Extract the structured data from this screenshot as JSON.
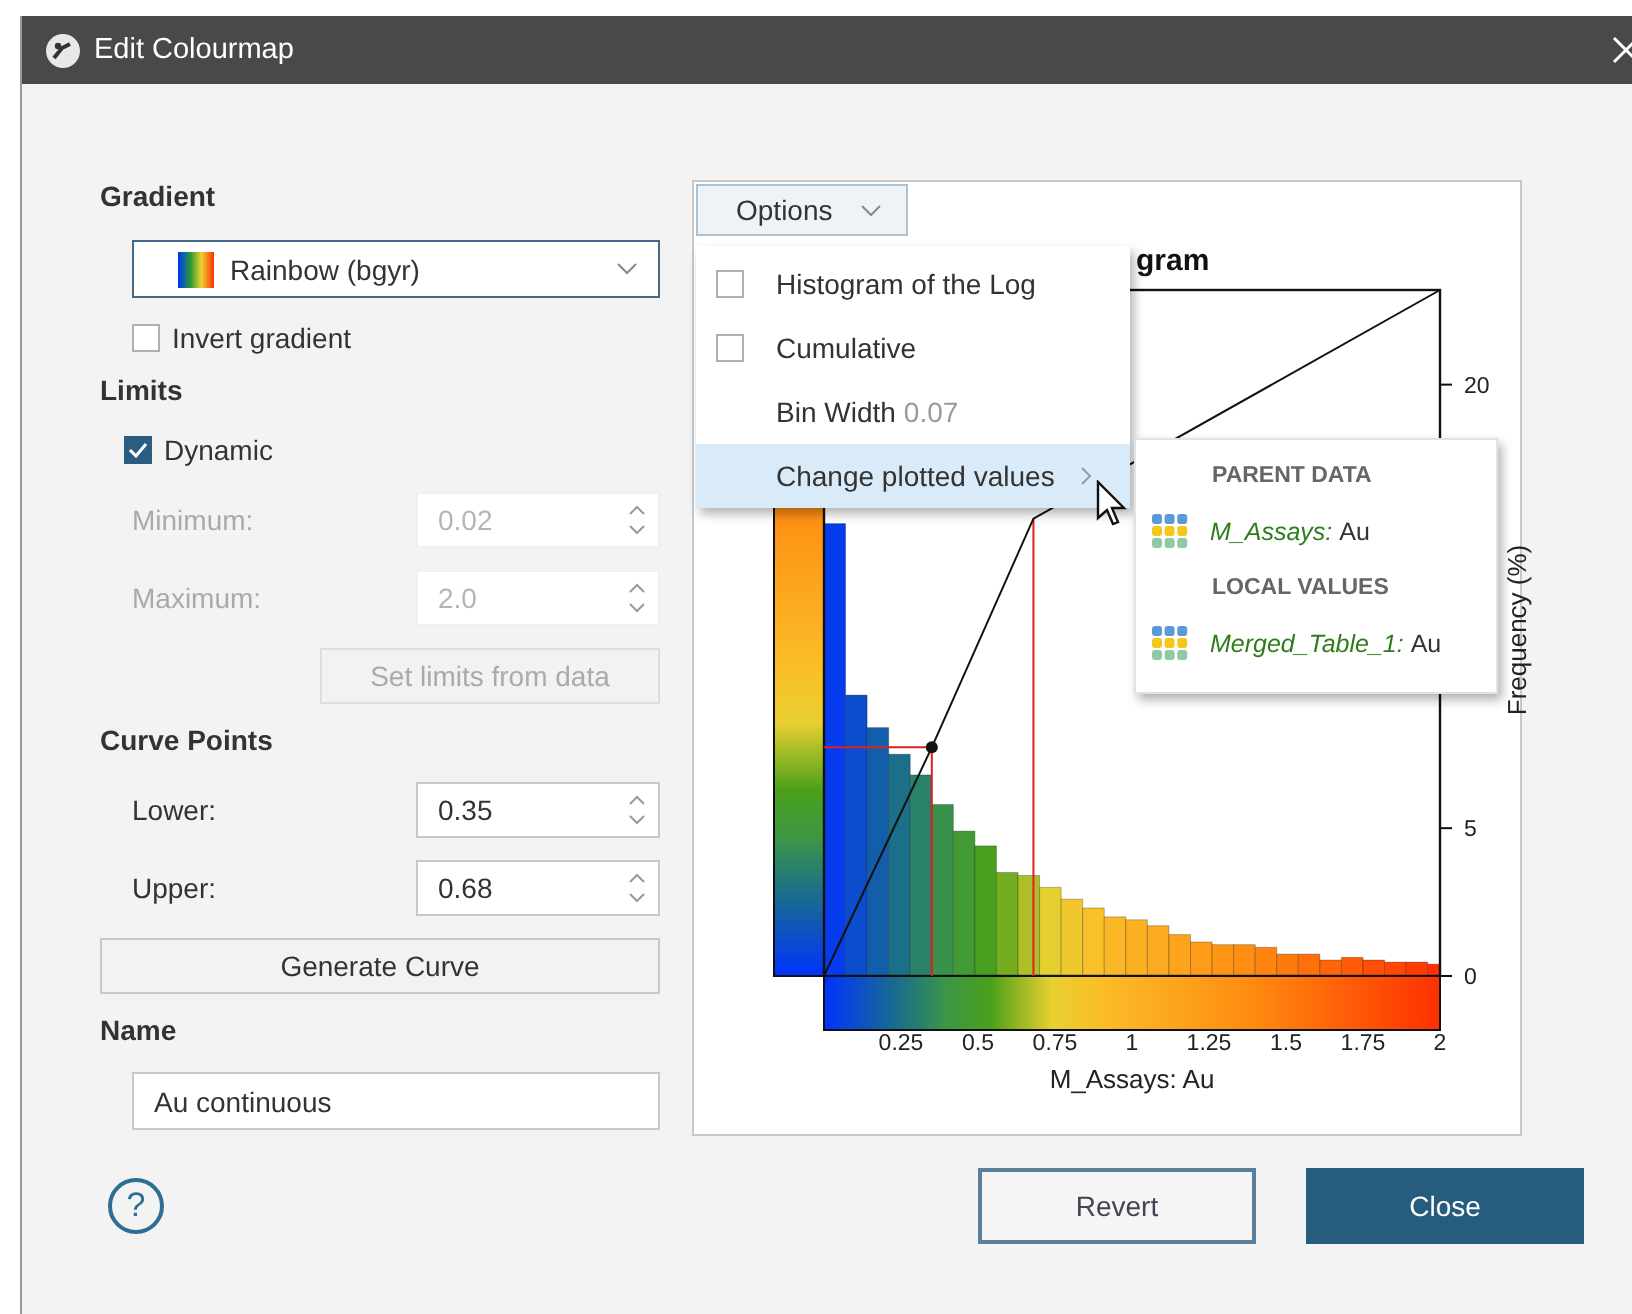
{
  "window": {
    "title": "Edit Colourmap"
  },
  "gradient": {
    "label": "Gradient",
    "value": "Rainbow (bgyr)",
    "invert": {
      "label": "Invert gradient",
      "checked": false
    }
  },
  "limits": {
    "label": "Limits",
    "dynamic": {
      "label": "Dynamic",
      "checked": true
    },
    "fields": [
      {
        "label": "Minimum:",
        "value": "0.02",
        "disabled": true
      },
      {
        "label": "Maximum:",
        "value": "2.0",
        "disabled": true
      }
    ],
    "set_button": {
      "label": "Set limits from data",
      "disabled": true
    }
  },
  "curve_points": {
    "label": "Curve Points",
    "fields": [
      {
        "label": "Lower:",
        "value": "0.35",
        "disabled": false
      },
      {
        "label": "Upper:",
        "value": "0.68",
        "disabled": false
      }
    ],
    "generate_button": "Generate Curve"
  },
  "name": {
    "label": "Name",
    "value": "Au continuous"
  },
  "chart_panel": {
    "options_button": "Options",
    "menu": [
      {
        "kind": "checkbox",
        "label": "Histogram of the Log",
        "checked": false,
        "selected": false
      },
      {
        "kind": "checkbox",
        "label": "Cumulative",
        "checked": false,
        "selected": false
      },
      {
        "kind": "value",
        "label": "Bin Width",
        "value": "0.07",
        "selected": false
      },
      {
        "kind": "submenu",
        "label": "Change plotted values",
        "selected": true
      }
    ],
    "submenu": [
      {
        "header": "PARENT DATA",
        "items": [
          {
            "source": "M_Assays:",
            "attribute": "Au"
          }
        ]
      },
      {
        "header": "LOCAL VALUES",
        "items": [
          {
            "source": "Merged_Table_1:",
            "attribute": "Au"
          }
        ]
      }
    ],
    "chart_data": {
      "type": "bar",
      "title": "gram",
      "xlabel": "M_Assays: Au",
      "ylabel": "Frequency (%)",
      "xlim": [
        0,
        2
      ],
      "ylim": [
        0,
        23.2
      ],
      "xticks": [
        0.25,
        0.5,
        0.75,
        1,
        1.25,
        1.5,
        1.75,
        2
      ],
      "yticks": [
        0,
        5,
        20
      ],
      "x": [
        0.035,
        0.105,
        0.175,
        0.245,
        0.315,
        0.385,
        0.455,
        0.525,
        0.595,
        0.665,
        0.735,
        0.805,
        0.875,
        0.945,
        1.015,
        1.085,
        1.155,
        1.225,
        1.295,
        1.365,
        1.435,
        1.505,
        1.575,
        1.645,
        1.715,
        1.785,
        1.855,
        1.925,
        1.995
      ],
      "values": [
        15.3,
        9.5,
        8.4,
        7.5,
        6.8,
        5.8,
        4.9,
        4.4,
        3.5,
        3.4,
        3.0,
        2.6,
        2.3,
        2.0,
        1.9,
        1.7,
        1.4,
        1.15,
        1.06,
        1.06,
        0.97,
        0.74,
        0.74,
        0.54,
        0.63,
        0.54,
        0.47,
        0.47,
        0.4
      ]
    }
  },
  "help_button": "?",
  "buttons": [
    {
      "label": "Revert",
      "kind": "secondary"
    },
    {
      "label": "Close",
      "kind": "primary"
    }
  ]
}
